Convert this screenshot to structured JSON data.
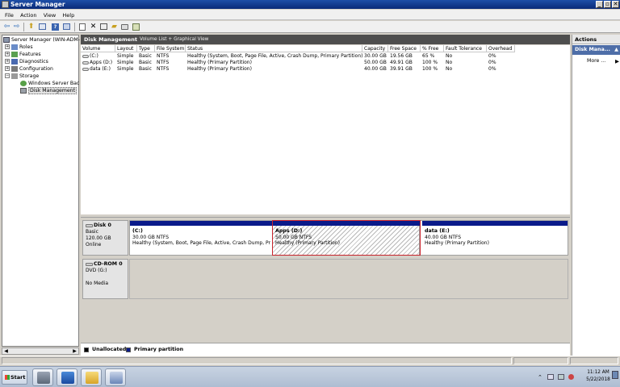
{
  "window": {
    "title": "Server Manager",
    "buttons": [
      "_",
      "▫",
      "✕"
    ]
  },
  "menu": [
    "File",
    "Action",
    "View",
    "Help"
  ],
  "toolbar_icons": [
    "back-arrow-icon",
    "forward-arrow-icon",
    "up-folder-icon",
    "console-tree-icon",
    "help-icon",
    "properties-icon",
    "refresh-icon",
    "delete-icon",
    "checklist-icon",
    "open-folder-icon",
    "search-disk-icon",
    "export-icon"
  ],
  "tree": {
    "root": "Server Manager (WIN-ADM-",
    "items": [
      {
        "label": "Roles",
        "expander": "+"
      },
      {
        "label": "Features",
        "expander": "+"
      },
      {
        "label": "Diagnostics",
        "expander": "+"
      },
      {
        "label": "Configuration",
        "expander": "+"
      },
      {
        "label": "Storage",
        "expander": "−"
      },
      {
        "label": "Windows Server Bac",
        "expander": ""
      },
      {
        "label": "Disk Management",
        "expander": ""
      }
    ]
  },
  "center": {
    "title": "Disk Management",
    "subtitle": "Volume List + Graphical View"
  },
  "volume_table": {
    "headers": [
      "Volume",
      "Layout",
      "Type",
      "File System",
      "Status",
      "Capacity",
      "Free Space",
      "% Free",
      "Fault Tolerance",
      "Overhead"
    ],
    "rows": [
      [
        "(C:)",
        "Simple",
        "Basic",
        "NTFS",
        "Healthy (System, Boot, Page File, Active, Crash Dump, Primary Partition)",
        "30.00 GB",
        "19.56 GB",
        "65 %",
        "No",
        "0%"
      ],
      [
        "Apps (D:)",
        "Simple",
        "Basic",
        "NTFS",
        "Healthy (Primary Partition)",
        "50.00 GB",
        "49.91 GB",
        "100 %",
        "No",
        "0%"
      ],
      [
        "data (E:)",
        "Simple",
        "Basic",
        "NTFS",
        "Healthy (Primary Partition)",
        "40.00 GB",
        "39.91 GB",
        "100 %",
        "No",
        "0%"
      ]
    ]
  },
  "disks": [
    {
      "name": "Disk 0",
      "type": "Basic",
      "size": "120.00 GB",
      "state": "Online",
      "partitions": [
        {
          "name": "(C:)",
          "size": "30.00 GB NTFS",
          "status": "Healthy (System, Boot, Page File, Active, Crash Dump, Pr"
        },
        {
          "name": "Apps  (D:)",
          "size": "50.00 GB NTFS",
          "status": "Healthy (Primary Partition)"
        },
        {
          "name": "data  (E:)",
          "size": "40.00 GB NTFS",
          "status": "Healthy (Primary Partition)"
        }
      ]
    },
    {
      "name": "CD-ROM 0",
      "type": "DVD (G:)",
      "media": "No Media"
    }
  ],
  "legend": [
    {
      "label": "Unallocated",
      "color": "#000000"
    },
    {
      "label": "Primary partition",
      "color": "#0a1a8a"
    }
  ],
  "actions": {
    "header": "Actions",
    "section": "Disk Mana...",
    "section_arrow": "▲",
    "more": "More ...",
    "more_arrow": "▶"
  },
  "taskbar": {
    "start": "Start",
    "tray_arrow": "⌃",
    "time": "11:12 AM",
    "date": "5/22/2018"
  },
  "colors": {
    "primary_partition": "#0a1a8a",
    "selection_outline": "#c8242c",
    "header_dark": "#4e4e4e",
    "actions_selected": "#4e6ea8"
  }
}
